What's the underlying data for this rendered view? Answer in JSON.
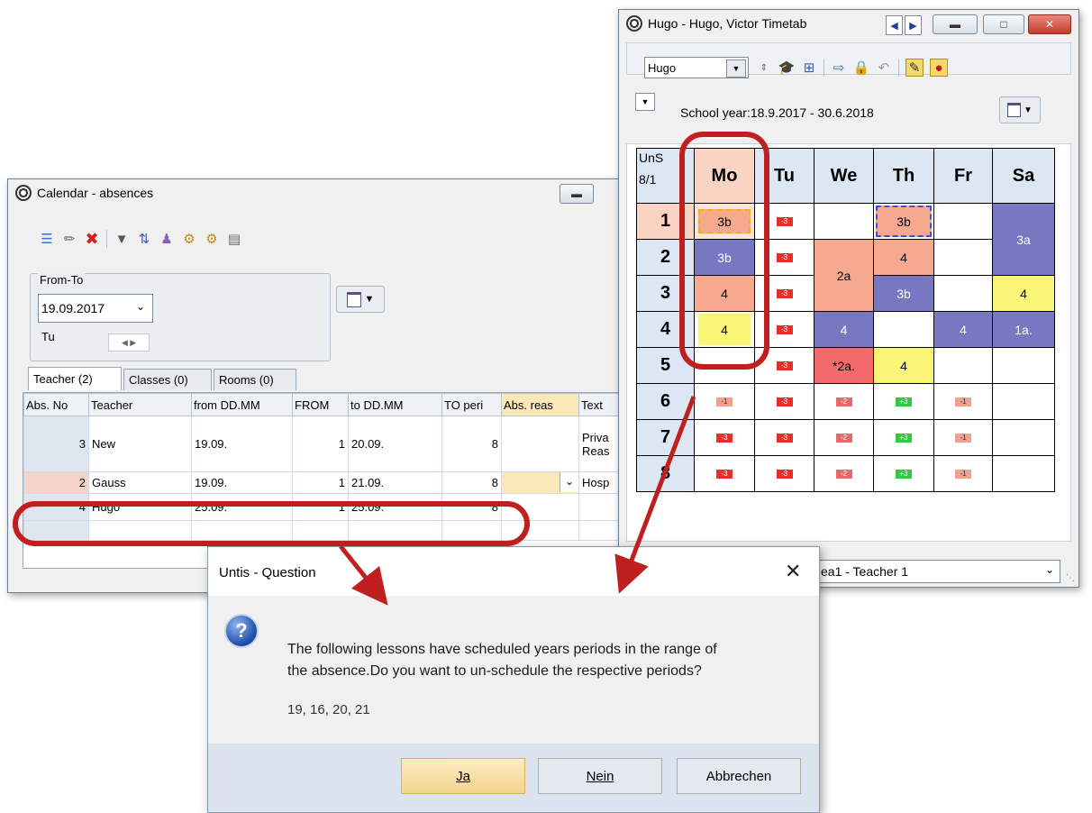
{
  "calendar": {
    "title": "Calendar - absences",
    "from_to_label": "From-To",
    "date_value": "19.09.2017",
    "weekday": "Tu",
    "tabs": [
      "Teacher (2)",
      "Classes (0)",
      "Rooms (0)"
    ],
    "columns": [
      "Abs. No",
      "Teacher",
      "from DD.MM",
      "FROM",
      "to DD.MM",
      "TO peri",
      "Abs. reas",
      "Text"
    ],
    "rows": [
      {
        "no": "3",
        "teacher": "New",
        "from": "19.09.",
        "from_p": "1",
        "to": "20.09.",
        "to_p": "8",
        "reason": "",
        "text1": "Priva",
        "text2": "Reas"
      },
      {
        "no": "2",
        "teacher": "Gauss",
        "from": "19.09.",
        "from_p": "1",
        "to": "21.09.",
        "to_p": "8",
        "reason": "",
        "text1": "Hosp",
        "text2": ""
      },
      {
        "no": "4",
        "teacher": "Hugo",
        "from": "25.09.",
        "from_p": "1",
        "to": "25.09.",
        "to_p": "8",
        "reason": "",
        "text1": "",
        "text2": ""
      }
    ]
  },
  "timetable": {
    "title": "Hugo - Hugo, Victor  Timetab",
    "combo_value": "Hugo",
    "school_year": "School year:18.9.2017 - 30.6.2018",
    "corner_1": "UnS",
    "corner_2": "8/1",
    "days": [
      "Mo",
      "Tu",
      "We",
      "Th",
      "Fr",
      "Sa"
    ],
    "periods": [
      "1",
      "2",
      "3",
      "4",
      "5",
      "6",
      "7",
      "8"
    ],
    "cells": {
      "mo1": "3b",
      "mo2": "3b",
      "mo3": "4",
      "mo4": "4",
      "we23": "2a",
      "we4": "4",
      "we5": "*2a.",
      "th1": "3b",
      "th2": "4",
      "th3": "3b",
      "th5": "4",
      "fr4": "4",
      "sa12": "3a",
      "sa3": "4",
      "sa4": "1a."
    },
    "mini": {
      "tu": "-3",
      "mo": "-1",
      "we": "-2",
      "th": "+3",
      "fr": "-1",
      "mo_r": "-3"
    },
    "footer_combo": "ea1 - Teacher 1"
  },
  "dialog": {
    "title": "Untis - Question",
    "message_line1": "The following lessons have scheduled years periods in the range of",
    "message_line2": "the absence.Do you want to un-schedule the respective periods?",
    "lessons": "19, 16, 20, 21",
    "btn_yes": "Ja",
    "btn_no": "Nein",
    "btn_cancel": "Abbrechen"
  },
  "colors": {
    "salmon": "#f6a98f",
    "purple": "#7777c2",
    "yellow": "#faf577",
    "pink_red": "#f46a6a",
    "highlight": "#bf1f1f"
  }
}
